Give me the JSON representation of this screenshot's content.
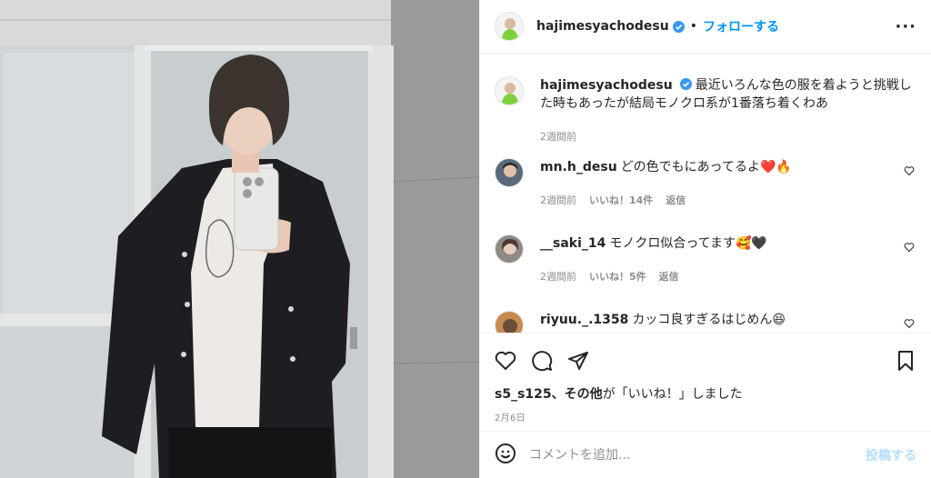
{
  "post": {
    "username": "hajimesyachodesu",
    "verified": true,
    "separator": "•",
    "follow_label": "フォローする",
    "more_label": "···",
    "caption": "最近いろんな色の服を着ようと挑戦した時もあったが結局モノクロ系が1番落ち着くわあ",
    "caption_time": "2週間前"
  },
  "comments": [
    {
      "username": "mn.h_desu",
      "text": "どの色でもにあってるよ❤️🔥",
      "time": "2週間前",
      "likes": "いいね！14件",
      "reply": "返信"
    },
    {
      "username": "__saki_14",
      "text": "モノクロ似合ってます🥰🖤",
      "time": "2週間前",
      "likes": "いいね！5件",
      "reply": "返信"
    },
    {
      "username": "riyuu._.1358",
      "text": "カッコ良すぎるはじめん😆",
      "time": "",
      "likes": "",
      "reply": ""
    }
  ],
  "likes_line": {
    "users": "s5_s125、",
    "others": "その他",
    "suffix": "が「いいね！」しました"
  },
  "date": "2月6日",
  "comment_box": {
    "placeholder": "コメントを追加...",
    "post_label": "投稿する"
  },
  "icons": [
    "heart-icon",
    "comment-icon",
    "share-icon",
    "bookmark-icon",
    "emoji-icon"
  ],
  "colors": {
    "accent": "#0095f6",
    "post_disabled": "#b2dffc",
    "verified": "#3897f0",
    "like_red": "#ed4956"
  }
}
